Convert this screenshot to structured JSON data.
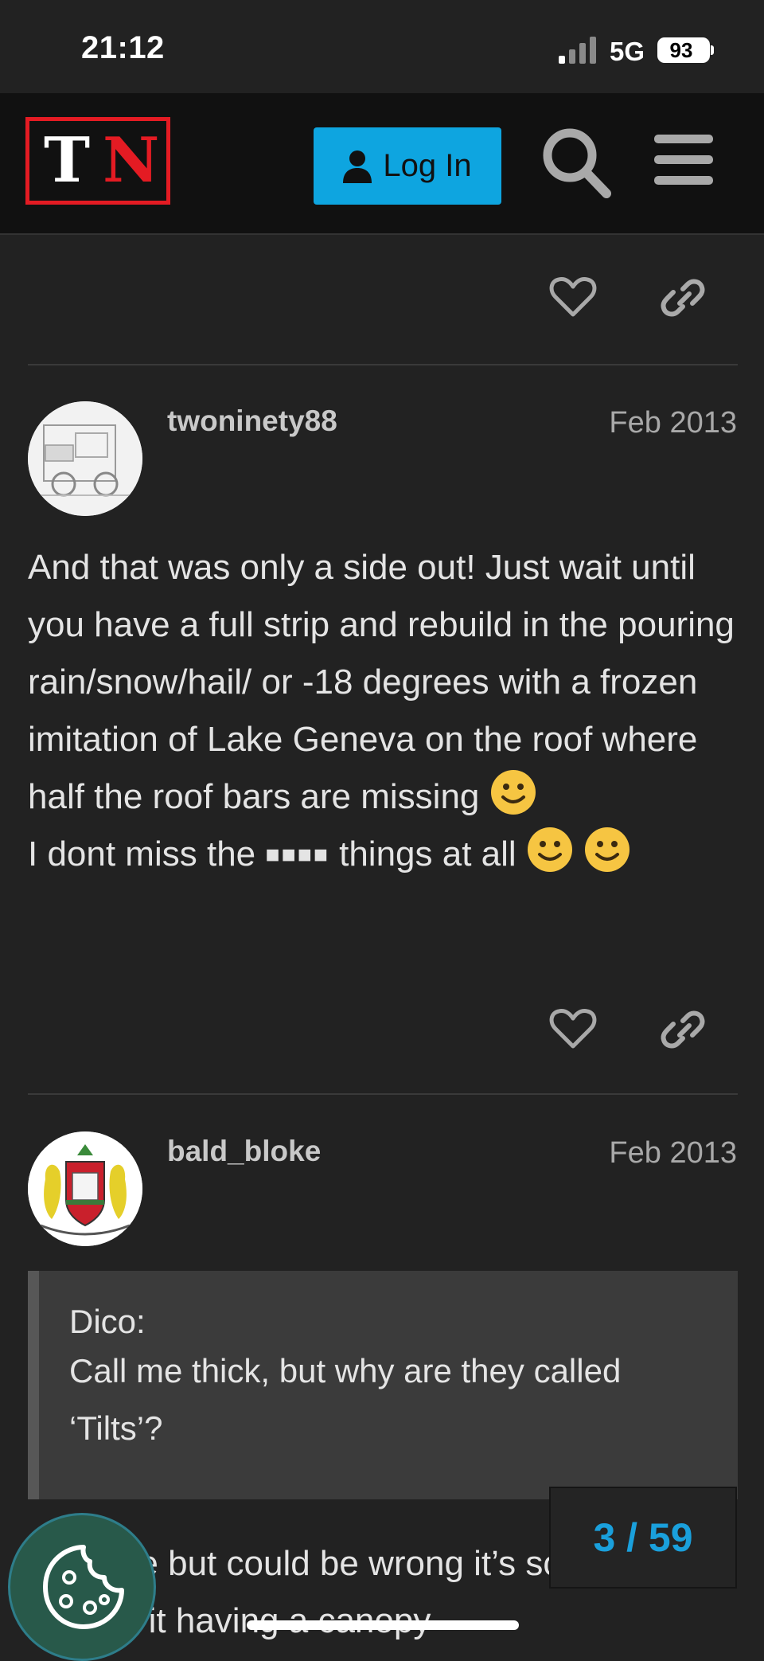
{
  "status_bar": {
    "time": "21:12",
    "network": "5G",
    "battery": "93"
  },
  "header": {
    "logo_t": "T",
    "logo_n": "N",
    "login_label": "Log In"
  },
  "posts": [
    {
      "username": "twoninety88",
      "date": "Feb 2013",
      "line1": "And that was only a side out! Just wait until you have a full strip and rebuild in the pouring rain/snow/hail/ or -18 degrees with a frozen imitation of Lake Geneva on the roof where half the roof bars are missing",
      "line2_start": "I dont miss the",
      "censored": "■■■■",
      "line2_end": "things at all"
    },
    {
      "username": "bald_bloke",
      "date": "Feb 2013",
      "quote_author": "Dico:",
      "quote_text": "Call me thick, but why are they called ‘Tilts’?",
      "body": "I believe but could be wrong it’s something to do with it having a canopy"
    }
  ],
  "progress": {
    "label": "3 / 59",
    "current": 3,
    "total": 59
  },
  "colors": {
    "accent": "#0ea5e0",
    "brand_red": "#e41b23",
    "background": "#222222"
  },
  "icons": [
    "person-icon",
    "search-icon",
    "menu-icon",
    "heart-icon",
    "link-icon",
    "cookie-icon",
    "smile-emoji"
  ]
}
